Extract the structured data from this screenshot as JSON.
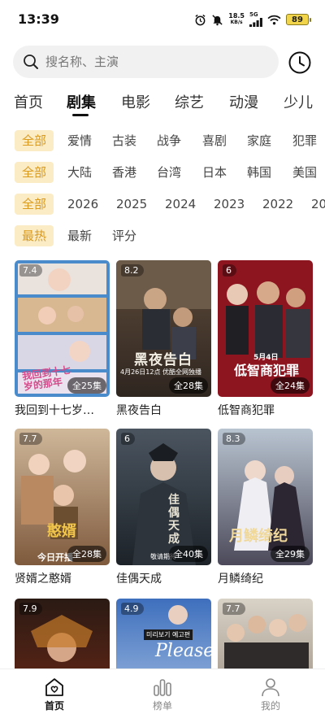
{
  "status_bar": {
    "time": "13:39",
    "net_speed_value": "18.5",
    "net_speed_unit": "KB/s",
    "network": "5G",
    "battery": "89",
    "icons": [
      "alarm-icon",
      "mute-icon",
      "signal-icon",
      "wifi-icon",
      "battery-icon"
    ]
  },
  "search": {
    "placeholder": "搜名称、主演",
    "history_icon": "clock-icon"
  },
  "categories": [
    "首页",
    "剧集",
    "电影",
    "综艺",
    "动漫",
    "少儿"
  ],
  "active_category": "剧集",
  "filters": {
    "genre": [
      "全部",
      "爱情",
      "古装",
      "战争",
      "喜剧",
      "家庭",
      "犯罪"
    ],
    "region": [
      "全部",
      "大陆",
      "香港",
      "台湾",
      "日本",
      "韩国",
      "美国"
    ],
    "year": [
      "全部",
      "2026",
      "2025",
      "2024",
      "2023",
      "2022",
      "20"
    ],
    "sort": [
      "最热",
      "最新",
      "评分"
    ]
  },
  "accent_color": "#d99a1e",
  "chip_bg": "#fbecc6",
  "shows": [
    {
      "title": "我回到十七岁…",
      "rating": "7.4",
      "episodes": "全25集",
      "poster_text": "我回到十七岁的那年"
    },
    {
      "title": "黑夜告白",
      "rating": "8.2",
      "episodes": "全28集",
      "poster_text": "黑夜告白",
      "poster_sub": "4月26日12点 优酷全网独播"
    },
    {
      "title": "低智商犯罪",
      "rating": "6",
      "episodes": "全24集",
      "poster_text": "低智商犯罪",
      "poster_sub": "5月4日"
    },
    {
      "title": "贤婿之憨婿",
      "rating": "7.7",
      "episodes": "全28集",
      "poster_text": "憨婿",
      "poster_sub": "今日开播"
    },
    {
      "title": "佳偶天成",
      "rating": "6",
      "episodes": "全40集",
      "poster_text": "佳偶天成",
      "poster_sub": "敬请期待"
    },
    {
      "title": "月鳞绮纪",
      "rating": "8.3",
      "episodes": "全29集",
      "poster_text": "月鳞绮纪"
    },
    {
      "title": "",
      "rating": "7.9",
      "episodes": ""
    },
    {
      "title": "",
      "rating": "4.9",
      "episodes": "",
      "poster_text": "Please,",
      "poster_sub": "미리보기 예고편"
    },
    {
      "title": "",
      "rating": "7.7",
      "episodes": ""
    }
  ],
  "bottom_nav": [
    {
      "label": "首页",
      "icon": "home-icon",
      "active": true
    },
    {
      "label": "榜单",
      "icon": "chart-icon",
      "active": false
    },
    {
      "label": "我的",
      "icon": "profile-icon",
      "active": false
    }
  ]
}
